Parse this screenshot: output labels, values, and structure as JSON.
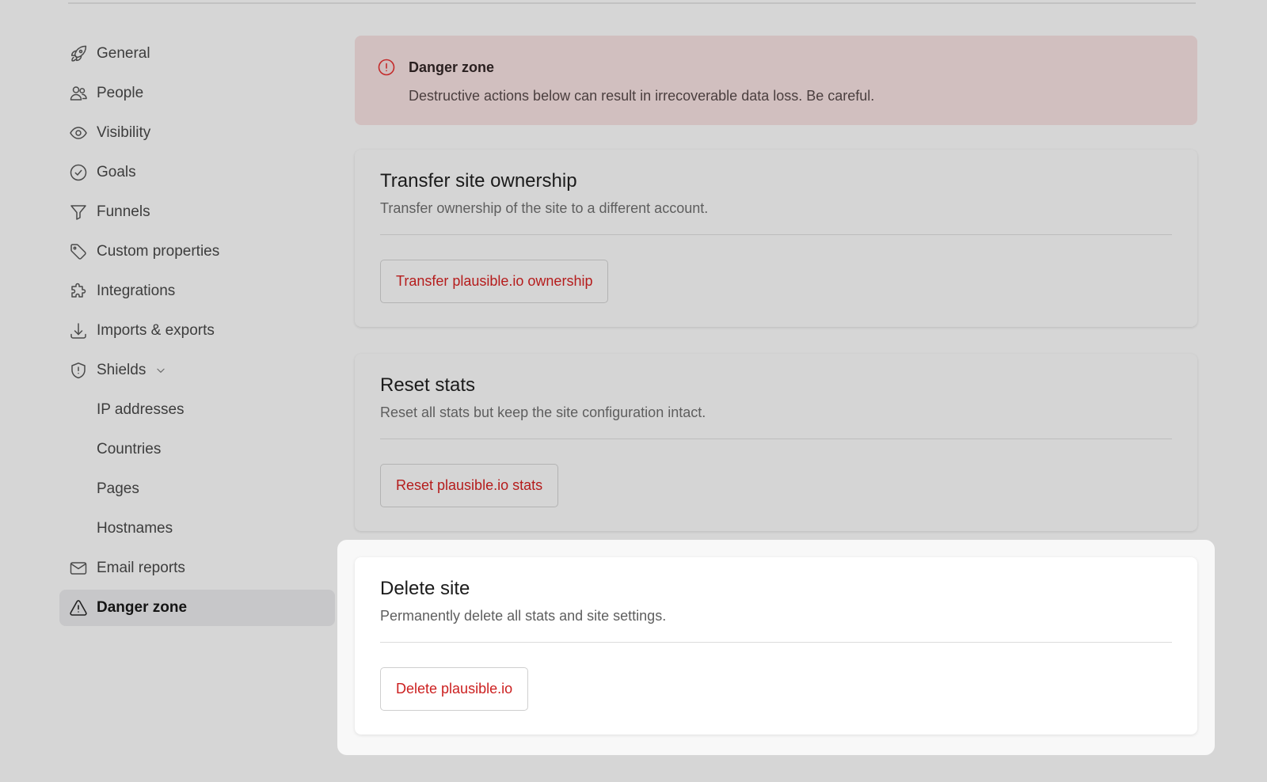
{
  "sidebar": {
    "items": [
      {
        "label": "General",
        "icon": "rocket-icon"
      },
      {
        "label": "People",
        "icon": "people-icon"
      },
      {
        "label": "Visibility",
        "icon": "eye-icon"
      },
      {
        "label": "Goals",
        "icon": "check-circle-icon"
      },
      {
        "label": "Funnels",
        "icon": "funnel-icon"
      },
      {
        "label": "Custom properties",
        "icon": "tag-icon"
      },
      {
        "label": "Integrations",
        "icon": "puzzle-icon"
      },
      {
        "label": "Imports & exports",
        "icon": "download-icon"
      },
      {
        "label": "Shields",
        "icon": "shield-icon"
      },
      {
        "label": "IP addresses"
      },
      {
        "label": "Countries"
      },
      {
        "label": "Pages"
      },
      {
        "label": "Hostnames"
      },
      {
        "label": "Email reports",
        "icon": "envelope-icon"
      },
      {
        "label": "Danger zone",
        "icon": "warning-icon",
        "active": true
      }
    ]
  },
  "alert": {
    "title": "Danger zone",
    "text": "Destructive actions below can result in irrecoverable data loss. Be careful.",
    "icon": "exclamation-circle-icon"
  },
  "cards": {
    "transfer": {
      "title": "Transfer site ownership",
      "description": "Transfer ownership of the site to a different account.",
      "button": "Transfer plausible.io ownership"
    },
    "reset": {
      "title": "Reset stats",
      "description": "Reset all stats but keep the site configuration intact.",
      "button": "Reset plausible.io stats"
    },
    "delete": {
      "title": "Delete site",
      "description": "Permanently delete all stats and site settings.",
      "button": "Delete plausible.io"
    }
  },
  "colors": {
    "danger": "#cc1f1f",
    "alert_bg": "#d1bfbf",
    "active_bg": "#c7c7c9"
  }
}
